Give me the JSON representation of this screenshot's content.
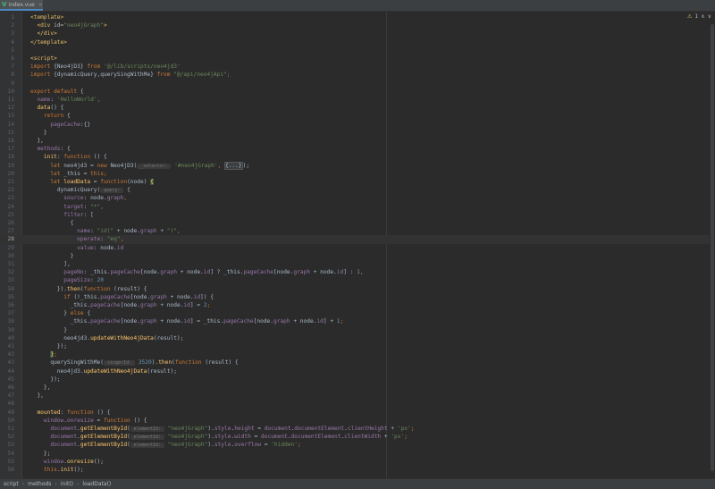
{
  "tab": {
    "label": "index.vue",
    "close": "×",
    "icon": "V"
  },
  "inspection": {
    "warnings": "1",
    "warn_icon": "⚠",
    "nav_up": "∧",
    "nav_down": "∨"
  },
  "breadcrumb": [
    "script",
    "methods",
    "init()",
    "loadData()"
  ],
  "breadcrumb_sep": "›",
  "current_line": 28,
  "lines": [
    [
      [
        "<template>",
        "t-tag"
      ]
    ],
    [
      [
        "  ",
        "t-id"
      ],
      [
        "<div ",
        "t-tag"
      ],
      [
        "id=",
        "t-attr"
      ],
      [
        "\"neo4jGraph\"",
        "t-str"
      ],
      [
        ">",
        "t-tag"
      ]
    ],
    [
      [
        "  ",
        "t-id"
      ],
      [
        "</div>",
        "t-tag"
      ]
    ],
    [
      [
        "</template>",
        "t-tag"
      ]
    ],
    [],
    [
      [
        "<script>",
        "t-tag"
      ]
    ],
    [
      [
        "import ",
        "t-kw"
      ],
      [
        "{Neo4jD3} ",
        "t-id"
      ],
      [
        "from ",
        "t-kw"
      ],
      [
        "'@/lib/scripts/neo4jd3'",
        "t-str"
      ]
    ],
    [
      [
        "import ",
        "t-kw"
      ],
      [
        "{dynamicQuery,querySingWithMe} ",
        "t-id"
      ],
      [
        "from ",
        "t-kw"
      ],
      [
        "\"@/api/neo4jApi\";",
        "t-str"
      ]
    ],
    [],
    [
      [
        "export default ",
        "t-kw"
      ],
      [
        "{",
        "t-id"
      ]
    ],
    [
      [
        "  ",
        "t-id"
      ],
      [
        "name",
        "t-prop"
      ],
      [
        ": ",
        "t-id"
      ],
      [
        "'HelloWorld'",
        "t-str"
      ],
      [
        ",",
        "t-kw"
      ]
    ],
    [
      [
        "  ",
        "t-id"
      ],
      [
        "data",
        "t-fn"
      ],
      [
        "() {",
        "t-id"
      ]
    ],
    [
      [
        "    ",
        "t-id"
      ],
      [
        "return ",
        "t-kw"
      ],
      [
        "{",
        "t-id"
      ]
    ],
    [
      [
        "      ",
        "t-id"
      ],
      [
        "pageCache",
        "t-prop"
      ],
      [
        ":{}",
        "t-id"
      ]
    ],
    [
      [
        "    }",
        "t-id"
      ]
    ],
    [
      [
        "  },",
        "t-id"
      ]
    ],
    [
      [
        "  ",
        "t-id"
      ],
      [
        "methods",
        "t-prop"
      ],
      [
        ": {",
        "t-id"
      ]
    ],
    [
      [
        "    ",
        "t-id"
      ],
      [
        "init",
        "t-fn"
      ],
      [
        ": ",
        "t-id"
      ],
      [
        "function ",
        "t-kw"
      ],
      [
        "() {",
        "t-id"
      ]
    ],
    [
      [
        "      ",
        "t-id"
      ],
      [
        "let ",
        "t-kw"
      ],
      [
        "neo4jd3 = ",
        "t-id"
      ],
      [
        "new ",
        "t-kw"
      ],
      [
        "Neo4jD3(",
        "t-id"
      ],
      [
        " _selector: ",
        "t-hint"
      ],
      [
        " '#neo4jGraph'",
        "t-str"
      ],
      [
        ", ",
        "t-kw"
      ],
      [
        "{...}",
        "t-fold"
      ],
      [
        ");",
        "t-id"
      ]
    ],
    [
      [
        "      ",
        "t-id"
      ],
      [
        "let ",
        "t-kw"
      ],
      [
        "_this = ",
        "t-id"
      ],
      [
        "this",
        "t-this"
      ],
      [
        ";",
        "t-kw"
      ]
    ],
    [
      [
        "      ",
        "t-id"
      ],
      [
        "let ",
        "t-kw"
      ],
      [
        "loadData",
        "t-fn"
      ],
      [
        " = ",
        "t-id"
      ],
      [
        "function",
        "t-kw"
      ],
      [
        "(node) ",
        "t-id"
      ],
      [
        "{",
        "t-brk"
      ]
    ],
    [
      [
        "        ",
        "t-id"
      ],
      [
        "dynamicQuery(",
        "t-id"
      ],
      [
        " query: ",
        "t-hint"
      ],
      [
        " {",
        "t-id"
      ]
    ],
    [
      [
        "          ",
        "t-id"
      ],
      [
        "source",
        "t-prop"
      ],
      [
        ": node.",
        "t-id"
      ],
      [
        "graph",
        "t-prop"
      ],
      [
        ",",
        "t-kw"
      ]
    ],
    [
      [
        "          ",
        "t-id"
      ],
      [
        "target",
        "t-prop"
      ],
      [
        ": ",
        "t-id"
      ],
      [
        "\"*\"",
        "t-str"
      ],
      [
        ",",
        "t-kw"
      ]
    ],
    [
      [
        "          ",
        "t-id"
      ],
      [
        "filter",
        "t-prop"
      ],
      [
        ": [",
        "t-id"
      ]
    ],
    [
      [
        "            {",
        "t-id"
      ]
    ],
    [
      [
        "              ",
        "t-id"
      ],
      [
        "name",
        "t-prop"
      ],
      [
        ": ",
        "t-id"
      ],
      [
        "\"id(\" ",
        "t-str"
      ],
      [
        "+ node.",
        "t-id"
      ],
      [
        "graph ",
        "t-prop"
      ],
      [
        "+ ",
        "t-id"
      ],
      [
        "\")\"",
        "t-str"
      ],
      [
        ",",
        "t-kw"
      ]
    ],
    [
      [
        "              ",
        "t-id"
      ],
      [
        "operate",
        "t-prop"
      ],
      [
        ": ",
        "t-id"
      ],
      [
        "\"eq\"",
        "t-str"
      ],
      [
        ",",
        "t-kw"
      ]
    ],
    [
      [
        "              ",
        "t-id"
      ],
      [
        "value",
        "t-prop"
      ],
      [
        ": node.",
        "t-id"
      ],
      [
        "id",
        "t-prop"
      ]
    ],
    [
      [
        "            }",
        "t-id"
      ]
    ],
    [
      [
        "          ],",
        "t-id"
      ]
    ],
    [
      [
        "          ",
        "t-id"
      ],
      [
        "pageNo",
        "t-prop"
      ],
      [
        ": _this.",
        "t-id"
      ],
      [
        "pageCache",
        "t-prop"
      ],
      [
        "[node.",
        "t-id"
      ],
      [
        "graph ",
        "t-prop"
      ],
      [
        "+ node.",
        "t-id"
      ],
      [
        "id",
        "t-prop"
      ],
      [
        "] ? _this.",
        "t-id"
      ],
      [
        "pageCache",
        "t-prop"
      ],
      [
        "[node.",
        "t-id"
      ],
      [
        "graph ",
        "t-prop"
      ],
      [
        "+ node.",
        "t-id"
      ],
      [
        "id",
        "t-prop"
      ],
      [
        "] : ",
        "t-id"
      ],
      [
        "1",
        "t-num"
      ],
      [
        ",",
        "t-kw"
      ]
    ],
    [
      [
        "          ",
        "t-id"
      ],
      [
        "pageSize",
        "t-prop"
      ],
      [
        ": ",
        "t-id"
      ],
      [
        "20",
        "t-num"
      ]
    ],
    [
      [
        "        }).",
        "t-id"
      ],
      [
        "then",
        "t-fn"
      ],
      [
        "(",
        "t-id"
      ],
      [
        "function ",
        "t-kw"
      ],
      [
        "(result) {",
        "t-id"
      ]
    ],
    [
      [
        "          ",
        "t-id"
      ],
      [
        "if ",
        "t-kw"
      ],
      [
        "(!_this.",
        "t-id"
      ],
      [
        "pageCache",
        "t-prop"
      ],
      [
        "[node.",
        "t-id"
      ],
      [
        "graph ",
        "t-prop"
      ],
      [
        "+ node.",
        "t-id"
      ],
      [
        "id",
        "t-prop"
      ],
      [
        "]) {",
        "t-id"
      ]
    ],
    [
      [
        "            _this.",
        "t-id"
      ],
      [
        "pageCache",
        "t-prop"
      ],
      [
        "[node.",
        "t-id"
      ],
      [
        "graph ",
        "t-prop"
      ],
      [
        "+ node.",
        "t-id"
      ],
      [
        "id",
        "t-prop"
      ],
      [
        "] = ",
        "t-id"
      ],
      [
        "2",
        "t-num"
      ],
      [
        ";",
        "t-kw"
      ]
    ],
    [
      [
        "          } ",
        "t-id"
      ],
      [
        "else ",
        "t-kw"
      ],
      [
        "{",
        "t-id"
      ]
    ],
    [
      [
        "            _this.",
        "t-id"
      ],
      [
        "pageCache",
        "t-prop"
      ],
      [
        "[node.",
        "t-id"
      ],
      [
        "graph ",
        "t-prop"
      ],
      [
        "+ node.",
        "t-id"
      ],
      [
        "id",
        "t-prop"
      ],
      [
        "] = _this.",
        "t-id"
      ],
      [
        "pageCache",
        "t-prop"
      ],
      [
        "[node.",
        "t-id"
      ],
      [
        "graph ",
        "t-prop"
      ],
      [
        "+ node.",
        "t-id"
      ],
      [
        "id",
        "t-prop"
      ],
      [
        "] + ",
        "t-id"
      ],
      [
        "1",
        "t-num"
      ],
      [
        ";",
        "t-kw"
      ]
    ],
    [
      [
        "          }",
        "t-id"
      ]
    ],
    [
      [
        "          neo4jd3.",
        "t-id"
      ],
      [
        "updateWithNeo4jData",
        "t-fn"
      ],
      [
        "(result);",
        "t-id"
      ]
    ],
    [
      [
        "        });",
        "t-id"
      ]
    ],
    [
      [
        "      ",
        "t-id"
      ],
      [
        "}",
        "t-brk"
      ],
      [
        ";",
        "t-kw"
      ]
    ],
    [
      [
        "      ",
        "t-id"
      ],
      [
        "querySingWithMe(",
        "t-id"
      ],
      [
        " singerId: ",
        "t-hint"
      ],
      [
        " ",
        "t-id"
      ],
      [
        "3520",
        "t-num"
      ],
      [
        ").",
        "t-id"
      ],
      [
        "then",
        "t-fn"
      ],
      [
        "(",
        "t-id"
      ],
      [
        "function ",
        "t-kw"
      ],
      [
        "(result) {",
        "t-id"
      ]
    ],
    [
      [
        "        neo4jd3.",
        "t-id"
      ],
      [
        "updateWithNeo4jData",
        "t-fn"
      ],
      [
        "(result);",
        "t-id"
      ]
    ],
    [
      [
        "      });",
        "t-id"
      ]
    ],
    [
      [
        "    },",
        "t-id"
      ]
    ],
    [
      [
        "  },",
        "t-id"
      ]
    ],
    [],
    [
      [
        "  ",
        "t-id"
      ],
      [
        "mounted",
        "t-fn"
      ],
      [
        ": ",
        "t-id"
      ],
      [
        "function ",
        "t-kw"
      ],
      [
        "() {",
        "t-id"
      ]
    ],
    [
      [
        "    ",
        "t-id"
      ],
      [
        "window",
        "t-prop"
      ],
      [
        ".",
        "t-id"
      ],
      [
        "onresize ",
        "t-prop"
      ],
      [
        "= ",
        "t-id"
      ],
      [
        "function ",
        "t-kw"
      ],
      [
        "() {",
        "t-id"
      ]
    ],
    [
      [
        "      ",
        "t-id"
      ],
      [
        "document",
        "t-prop"
      ],
      [
        ".",
        "t-id"
      ],
      [
        "getElementById",
        "t-fn"
      ],
      [
        "(",
        "t-id"
      ],
      [
        " elementId: ",
        "t-hint"
      ],
      [
        " ",
        "t-id"
      ],
      [
        "\"neo4jGraph\"",
        "t-str"
      ],
      [
        ").",
        "t-id"
      ],
      [
        "style",
        "t-prop"
      ],
      [
        ".",
        "t-id"
      ],
      [
        "height ",
        "t-prop"
      ],
      [
        "= ",
        "t-id"
      ],
      [
        "document",
        "t-prop"
      ],
      [
        ".",
        "t-id"
      ],
      [
        "documentElement",
        "t-prop"
      ],
      [
        ".",
        "t-id"
      ],
      [
        "clientHeight ",
        "t-prop"
      ],
      [
        "+ ",
        "t-id"
      ],
      [
        "'px'",
        "t-str"
      ],
      [
        ";",
        "t-kw"
      ]
    ],
    [
      [
        "      ",
        "t-id"
      ],
      [
        "document",
        "t-prop"
      ],
      [
        ".",
        "t-id"
      ],
      [
        "getElementById",
        "t-fn"
      ],
      [
        "(",
        "t-id"
      ],
      [
        " elementId: ",
        "t-hint"
      ],
      [
        " ",
        "t-id"
      ],
      [
        "\"neo4jGraph\"",
        "t-str"
      ],
      [
        ").",
        "t-id"
      ],
      [
        "style",
        "t-prop"
      ],
      [
        ".",
        "t-id"
      ],
      [
        "width ",
        "t-prop"
      ],
      [
        "= ",
        "t-id"
      ],
      [
        "document",
        "t-prop"
      ],
      [
        ".",
        "t-id"
      ],
      [
        "documentElement",
        "t-prop"
      ],
      [
        ".",
        "t-id"
      ],
      [
        "clientWidth ",
        "t-prop"
      ],
      [
        "+ ",
        "t-id"
      ],
      [
        "'px'",
        "t-str"
      ],
      [
        ";",
        "t-kw"
      ]
    ],
    [
      [
        "      ",
        "t-id"
      ],
      [
        "document",
        "t-prop"
      ],
      [
        ".",
        "t-id"
      ],
      [
        "getElementById",
        "t-fn"
      ],
      [
        "(",
        "t-id"
      ],
      [
        " elementId: ",
        "t-hint"
      ],
      [
        " ",
        "t-id"
      ],
      [
        "\"neo4jGraph\"",
        "t-str"
      ],
      [
        ").",
        "t-id"
      ],
      [
        "style",
        "t-prop"
      ],
      [
        ".",
        "t-id"
      ],
      [
        "overflow ",
        "t-prop"
      ],
      [
        "= ",
        "t-id"
      ],
      [
        "'hidden'",
        "t-str"
      ],
      [
        ";",
        "t-kw"
      ]
    ],
    [
      [
        "    };",
        "t-id"
      ]
    ],
    [
      [
        "    ",
        "t-id"
      ],
      [
        "window",
        "t-prop"
      ],
      [
        ".",
        "t-id"
      ],
      [
        "onresize",
        "t-fn"
      ],
      [
        "();",
        "t-id"
      ]
    ],
    [
      [
        "    ",
        "t-id"
      ],
      [
        "this",
        "t-this"
      ],
      [
        ".",
        "t-id"
      ],
      [
        "init",
        "t-fn"
      ],
      [
        "();",
        "t-id"
      ]
    ]
  ]
}
